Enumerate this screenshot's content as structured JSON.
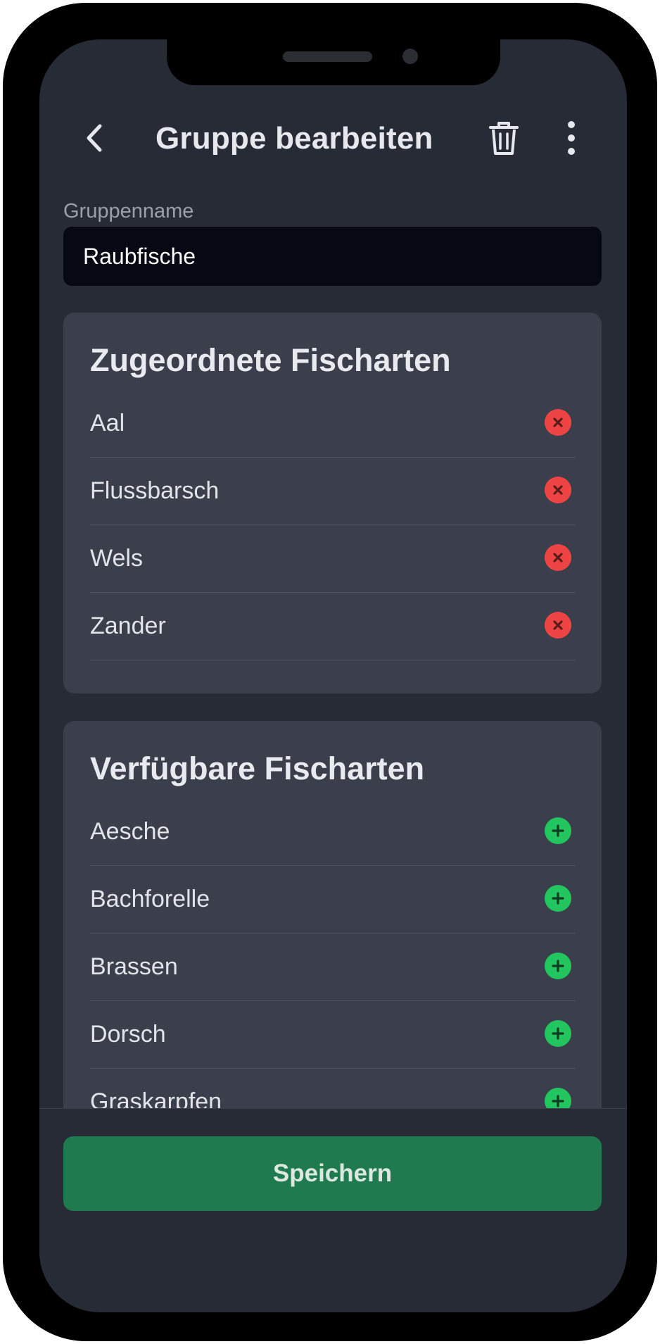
{
  "header": {
    "title": "Gruppe bearbeiten",
    "back_icon": "chevron-left-icon",
    "delete_icon": "trash-icon",
    "more_icon": "more-vertical-icon"
  },
  "group_name": {
    "label": "Gruppenname",
    "value": "Raubfische"
  },
  "assigned": {
    "title": "Zugeordnete Fischarten",
    "items": [
      {
        "label": "Aal"
      },
      {
        "label": "Flussbarsch"
      },
      {
        "label": "Wels"
      },
      {
        "label": "Zander"
      }
    ],
    "action_icon": "remove-icon",
    "action_color": "#ef4444"
  },
  "available": {
    "title": "Verfügbare Fischarten",
    "items": [
      {
        "label": "Aesche"
      },
      {
        "label": "Bachforelle"
      },
      {
        "label": "Brassen"
      },
      {
        "label": "Dorsch"
      },
      {
        "label": "Graskarpfen"
      }
    ],
    "action_icon": "add-icon",
    "action_color": "#22c55e"
  },
  "footer": {
    "save_label": "Speichern"
  },
  "colors": {
    "background": "#272b35",
    "card": "#3a3f4b",
    "primary_button": "#1f7a4f"
  }
}
